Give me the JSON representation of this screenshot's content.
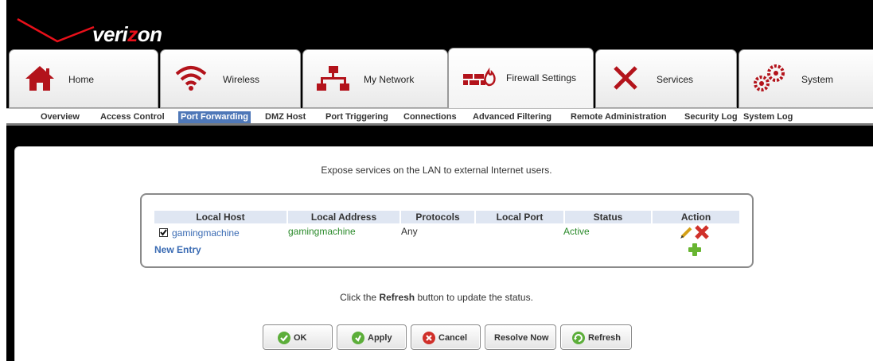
{
  "brand": {
    "logo_text_pre": "veri",
    "logo_text_z": "z",
    "logo_text_post": "on",
    "accent_color": "#e8101a"
  },
  "tabs": [
    {
      "label": "Home",
      "icon": "house-icon"
    },
    {
      "label": "Wireless",
      "icon": "wifi-icon"
    },
    {
      "label": "My Network",
      "icon": "network-icon"
    },
    {
      "label": "Firewall Settings",
      "icon": "firewall-icon",
      "active": true
    },
    {
      "label": "Services",
      "icon": "tools-icon"
    },
    {
      "label": "System",
      "icon": "gears-icon"
    }
  ],
  "subnav": [
    {
      "label": "Overview"
    },
    {
      "label": "Access Control"
    },
    {
      "label": "Port Forwarding",
      "active": true
    },
    {
      "label": "DMZ Host"
    },
    {
      "label": "Port Triggering"
    },
    {
      "label": "Connections"
    },
    {
      "label": "Advanced Filtering"
    },
    {
      "label": "Remote Administration"
    },
    {
      "label": "Security Log"
    },
    {
      "label": "System Log"
    }
  ],
  "main": {
    "description": "Expose services on the LAN to external Internet users.",
    "table": {
      "headers": [
        "Local Host",
        "Local Address",
        "Protocols",
        "Local Port",
        "Status",
        "Action"
      ],
      "rows": [
        {
          "checked": true,
          "local_host": "gamingmachine",
          "local_address": "gamingmachine",
          "protocols": "Any",
          "local_port": "",
          "status": "Active"
        }
      ],
      "new_entry_label": "New Entry"
    },
    "note_pre": "Click the ",
    "note_bold": "Refresh",
    "note_post": " button to update the status."
  },
  "buttons": {
    "ok": "OK",
    "apply": "Apply",
    "cancel": "Cancel",
    "resolve_now": "Resolve Now",
    "refresh": "Refresh"
  }
}
